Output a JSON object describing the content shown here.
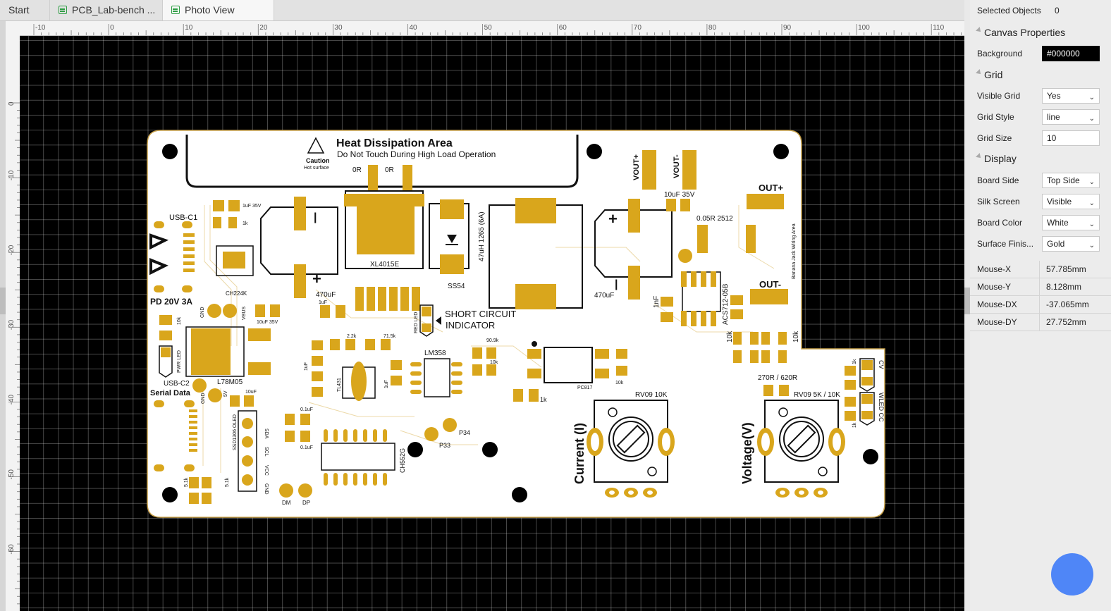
{
  "tabs": [
    {
      "label": "Start",
      "active": false
    },
    {
      "label": "PCB_Lab-bench ...",
      "active": false
    },
    {
      "label": "Photo View",
      "active": true
    }
  ],
  "ruler": {
    "horizontal": [
      "-10",
      "0",
      "10",
      "20",
      "30",
      "40",
      "50",
      "60",
      "70",
      "80",
      "90",
      "100",
      "110"
    ],
    "vertical": [
      "0",
      "-10",
      "-20",
      "-30",
      "-40",
      "-50",
      "-60"
    ]
  },
  "pcb": {
    "heat_title": "Heat Dissipation Area",
    "heat_subtitle": "Do Not Touch During High Load Operation",
    "caution": "Caution",
    "hot_surface": "Hot surface",
    "usb_c1": "USB-C1",
    "pd": "PD 20V 3A",
    "usb_c2": "USB-C2",
    "serial_data": "Serial Data",
    "short_circuit_1": "SHORT CIRCUIT",
    "short_circuit_2": "INDICATOR",
    "current": "Current (I)",
    "voltage": "Voltage(V)",
    "out_plus": "OUT+",
    "out_minus": "OUT-",
    "vout_plus": "VOUT+",
    "vout_minus": "VOUT-",
    "banana": "Banana Jack Wiring Area",
    "labels": {
      "or1": "0R",
      "or2": "0R",
      "xl4015": "XL4015E",
      "ss54": "SS54",
      "inductor": "47uH 1265 (6A)",
      "c470_1": "470uF",
      "c470_2": "470uF",
      "ch224k": "CH224K",
      "l78m05": "L78M05",
      "lm358": "LM358",
      "pc817": "PC817",
      "ch552g": "CH552G",
      "rv_current": "RV09 10K",
      "rv_voltage": "RV09 5K / 10K",
      "acs712": "ACS712-05B",
      "r_shunt": "0.05R 2512",
      "c10u35": "10uF 35V",
      "c1u35": "1uF 35V",
      "c10u35b": "10uF 35V",
      "c1u": "1uF",
      "k1": "1k",
      "k10": "10k",
      "k2_2": "2.2k",
      "k71_5": "71.5k",
      "k90_9": "90.9k",
      "r270": "270R / 620R",
      "p33": "P33",
      "p34": "P34",
      "dm": "DM",
      "dp": "DP",
      "gnd": "GND",
      "vbus": "VBUS",
      "v5": "5V",
      "pwr_led": "PWR LED",
      "red_led": "RED LED",
      "cv": "CV",
      "cc_led": "WLED CC",
      "oled": "SSD1306 OLED",
      "sda": "SDA",
      "scl": "SCL",
      "vcc": "VCC",
      "c01u": "0.1uF",
      "k5_1": "5.1k",
      "nf1": "1nF",
      "tl431": "TL431",
      "c10uf": "10uF"
    }
  },
  "panel": {
    "selected_label": "Selected Objects",
    "selected_value": "0",
    "canvas_section": "Canvas Properties",
    "background_label": "Background",
    "background_value": "#000000",
    "grid_section": "Grid",
    "visible_grid_label": "Visible Grid",
    "visible_grid_value": "Yes",
    "grid_style_label": "Grid Style",
    "grid_style_value": "line",
    "grid_size_label": "Grid Size",
    "grid_size_value": "10",
    "display_section": "Display",
    "board_side_label": "Board Side",
    "board_side_value": "Top Side",
    "silk_label": "Silk Screen",
    "silk_value": "Visible",
    "board_color_label": "Board Color",
    "board_color_value": "White",
    "surface_label": "Surface Finis...",
    "surface_value": "Gold"
  },
  "mouse": [
    {
      "label": "Mouse-X",
      "value": "57.785mm"
    },
    {
      "label": "Mouse-Y",
      "value": "8.128mm"
    },
    {
      "label": "Mouse-DX",
      "value": "-37.065mm"
    },
    {
      "label": "Mouse-DY",
      "value": "27.752mm"
    }
  ],
  "colors": {
    "gold": "#d9a61c",
    "board": "#ffffff",
    "canvas": "#000000",
    "fab": "#4f86f7"
  }
}
